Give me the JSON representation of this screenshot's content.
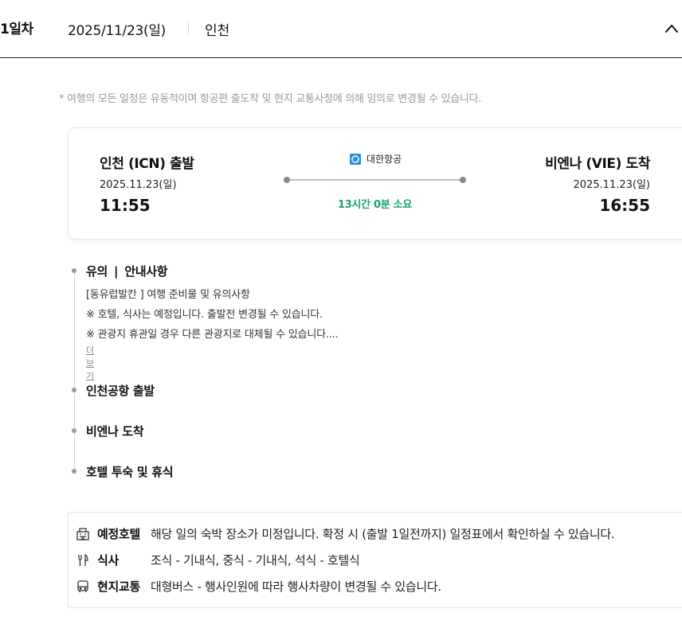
{
  "day": {
    "label": "1일차",
    "date": "2025/11/23(일)",
    "city": "인천"
  },
  "notice": "* 여행의 모든 일정은 유동적이며 항공편 출도착 및 현지 교통사정에 의해 임의로 변경될 수 있습니다.",
  "flight": {
    "departure": {
      "title": "인천 (ICN) 출발",
      "date": "2025.11.23(일)",
      "time": "11:55"
    },
    "arrival": {
      "title": "비엔나 (VIE) 도착",
      "date": "2025.11.23(일)",
      "time": "16:55"
    },
    "airline": "대한항공",
    "duration": "13시간 0분 소요",
    "colors": {
      "duration": "#1aa17a",
      "airline_logo": "#1f8fe0"
    }
  },
  "timeline": {
    "notes": {
      "title_a": "유의",
      "divider": "|",
      "title_b": "안내사항",
      "lines": [
        "[동유럽발칸 ] 여행 준비물 및 유의사항",
        "※ 호텔, 식사는 예정입니다. 출발전 변경될 수 있습니다.",
        "※ 관광지 휴관일 경우 다른 관광지로 대체될 수 있습니다...."
      ],
      "more": "더보기"
    },
    "items": [
      {
        "title": "인천공항 출발"
      },
      {
        "title": "비엔나 도착"
      },
      {
        "title": "호텔 투숙 및 휴식"
      }
    ]
  },
  "info": {
    "hotel": {
      "icon": "building-icon",
      "label": "예정호텔",
      "value": "해당 일의 숙박 장소가 미정입니다. 확정 시 (출발 1일전까지) 일정표에서 확인하실 수 있습니다."
    },
    "meal": {
      "icon": "utensils-icon",
      "label": "식사",
      "value": "조식 - 기내식, 중식 - 기내식, 석식 - 호텔식"
    },
    "transport": {
      "icon": "bus-icon",
      "label": "현지교통",
      "value": "대형버스 - 행사인원에 따라 행사차량이 변경될 수 있습니다."
    }
  }
}
